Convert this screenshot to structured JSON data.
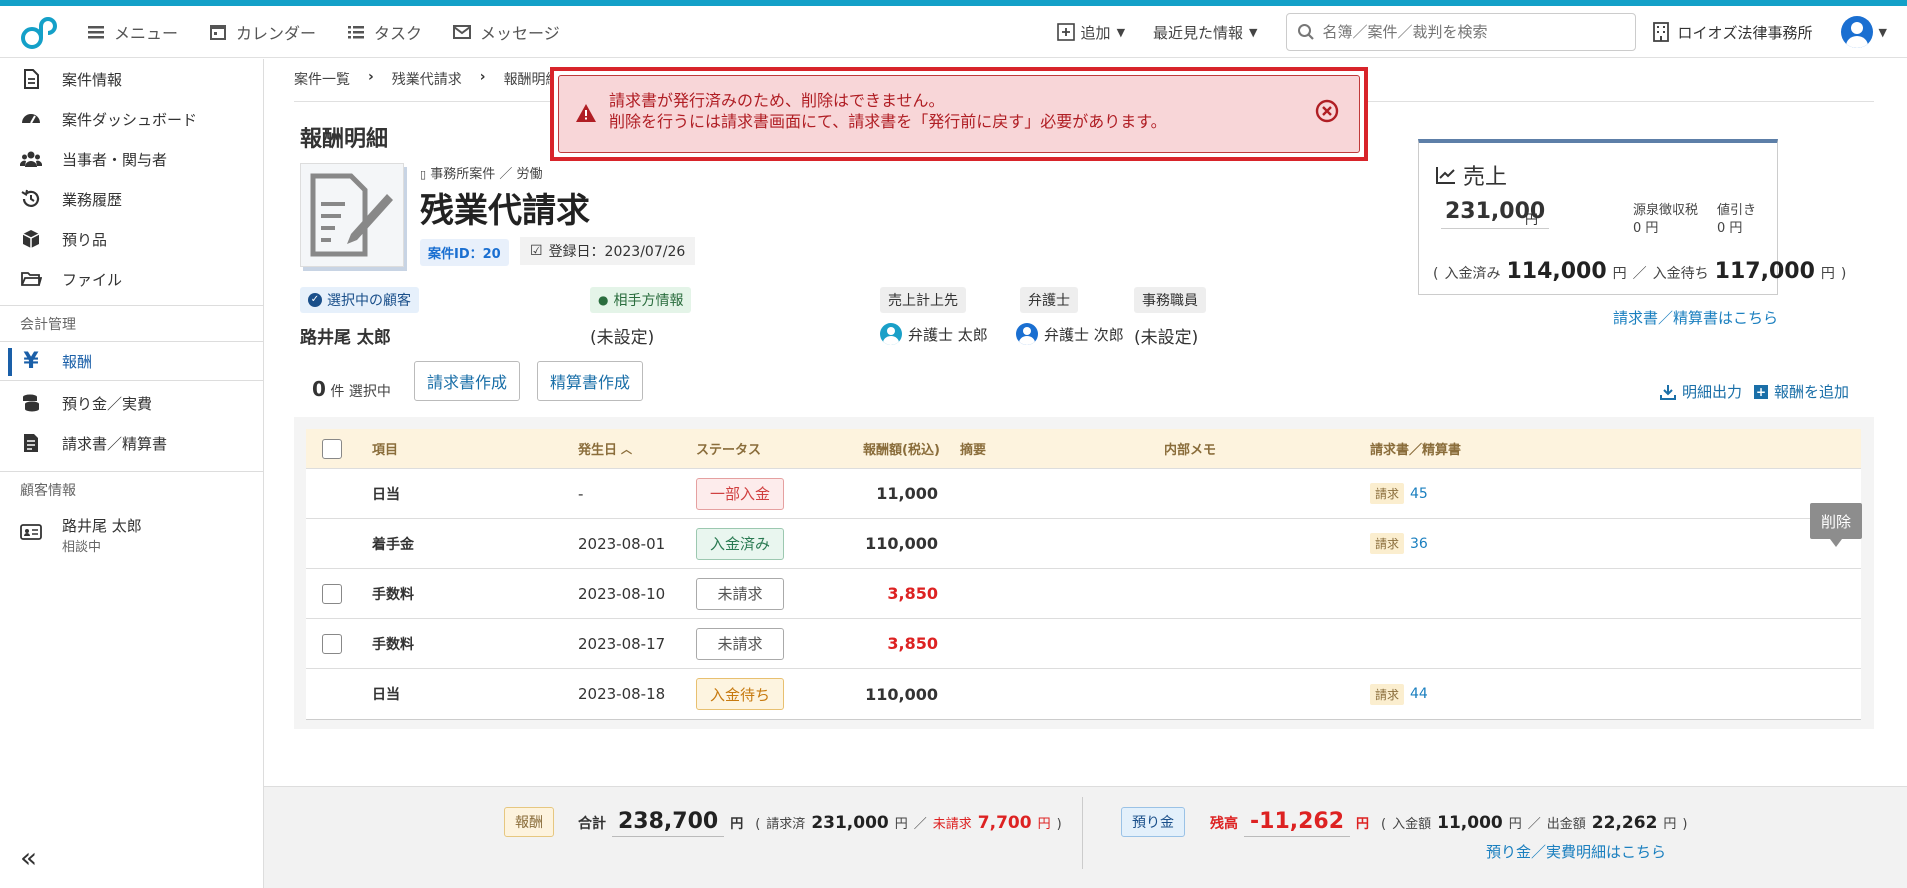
{
  "topnav": {
    "menu": "メニュー",
    "calendar": "カレンダー",
    "task": "タスク",
    "message": "メッセージ",
    "add": "追加",
    "recent": "最近見た情報",
    "search_placeholder": "名簿／案件／裁判を検索",
    "firm": "ロイオズ法律事務所"
  },
  "sidebar": {
    "items": [
      {
        "label": "案件情報",
        "icon": "document-icon"
      },
      {
        "label": "案件ダッシュボード",
        "icon": "dashboard-icon"
      },
      {
        "label": "当事者・関与者",
        "icon": "people-icon"
      },
      {
        "label": "業務履歴",
        "icon": "history-icon"
      },
      {
        "label": "預り品",
        "icon": "box-icon"
      },
      {
        "label": "ファイル",
        "icon": "folder-icon"
      }
    ],
    "section_accounting": "会計管理",
    "accounting_items": [
      {
        "label": "報酬",
        "icon": "yen-icon",
        "active": true
      },
      {
        "label": "預り金／実費",
        "icon": "coins-icon"
      },
      {
        "label": "請求書／精算書",
        "icon": "invoice-icon"
      }
    ],
    "section_client": "顧客情報",
    "client": {
      "name": "路井尾 太郎",
      "status": "相談中"
    }
  },
  "breadcrumb": [
    "案件一覧",
    "残業代請求",
    "報酬明細"
  ],
  "page_title": "報酬明細",
  "case": {
    "category": "事務所案件 ／ 労働",
    "name": "残業代請求",
    "id_label": "案件ID：20",
    "reg_date": "登録日：2023/07/26"
  },
  "parties": {
    "client_label": "選択中の顧客",
    "client_name": "路井尾 太郎",
    "opponent_label": "相手方情報",
    "opponent_value": "(未設定)",
    "sales_to_label": "売上計上先",
    "sales_to": "弁護士 太郎",
    "lawyer_label": "弁護士",
    "lawyer": "弁護士 次郎",
    "staff_label": "事務職員",
    "staff": "(未設定)"
  },
  "sales": {
    "title": "売上",
    "amount": "231,000",
    "unit": "円",
    "withholding_label": "源泉徴収税",
    "withholding": "0 円",
    "discount_label": "値引き",
    "discount": "0 円",
    "paid_label": "入金済み",
    "paid": "114,000",
    "waiting_label": "入金待ち",
    "waiting": "117,000",
    "invoice_link": "請求書／精算書はこちら"
  },
  "toolbar": {
    "selected_count": "0",
    "selected_suffix": "件 選択中",
    "create_invoice": "請求書作成",
    "create_settlement": "精算書作成",
    "export": "明細出力",
    "add_fee": "報酬を追加"
  },
  "table": {
    "headers": {
      "item": "項目",
      "date": "発生日",
      "status": "ステータス",
      "amount": "報酬額(税込)",
      "summary": "摘要",
      "memo": "内部メモ",
      "invoice": "請求書／精算書"
    },
    "rows": [
      {
        "item": "日当",
        "date": "-",
        "status": "一部入金",
        "status_type": "partial",
        "amount": "11,000",
        "red": false,
        "inv_tag": "請求",
        "inv_no": "45",
        "checkbox": false
      },
      {
        "item": "着手金",
        "date": "2023-08-01",
        "status": "入金済み",
        "status_type": "paid",
        "amount": "110,000",
        "red": false,
        "inv_tag": "請求",
        "inv_no": "36",
        "checkbox": false
      },
      {
        "item": "手数料",
        "date": "2023-08-10",
        "status": "未請求",
        "status_type": "unbilled",
        "amount": "3,850",
        "red": true,
        "inv_tag": "",
        "inv_no": "",
        "checkbox": true
      },
      {
        "item": "手数料",
        "date": "2023-08-17",
        "status": "未請求",
        "status_type": "unbilled",
        "amount": "3,850",
        "red": true,
        "inv_tag": "",
        "inv_no": "",
        "checkbox": true
      },
      {
        "item": "日当",
        "date": "2023-08-18",
        "status": "入金待ち",
        "status_type": "waiting",
        "amount": "110,000",
        "red": false,
        "inv_tag": "請求",
        "inv_no": "44",
        "checkbox": false
      }
    ],
    "delete_tooltip": "削除"
  },
  "footer": {
    "fee_tag": "報酬",
    "total_label": "合計",
    "total": "238,700",
    "yen": "円",
    "billed_label": "請求済",
    "billed": "231,000",
    "unbilled_label": "未請求",
    "unbilled": "7,700",
    "deposit_tag": "預り金",
    "balance_label": "残高",
    "balance": "-11,262",
    "in_label": "入金額",
    "in": "11,000",
    "out_label": "出金額",
    "out": "22,262",
    "deposit_link": "預り金／実費明細はこちら"
  },
  "alert": {
    "line1": "請求書が発行済みのため、削除はできません。",
    "line2": "削除を行うには請求書画面にて、請求書を「発行前に戻す」必要があります。"
  },
  "colors": {
    "accent": "#14a0c8",
    "alert": "#d8242a",
    "link": "#1a7fbf"
  }
}
